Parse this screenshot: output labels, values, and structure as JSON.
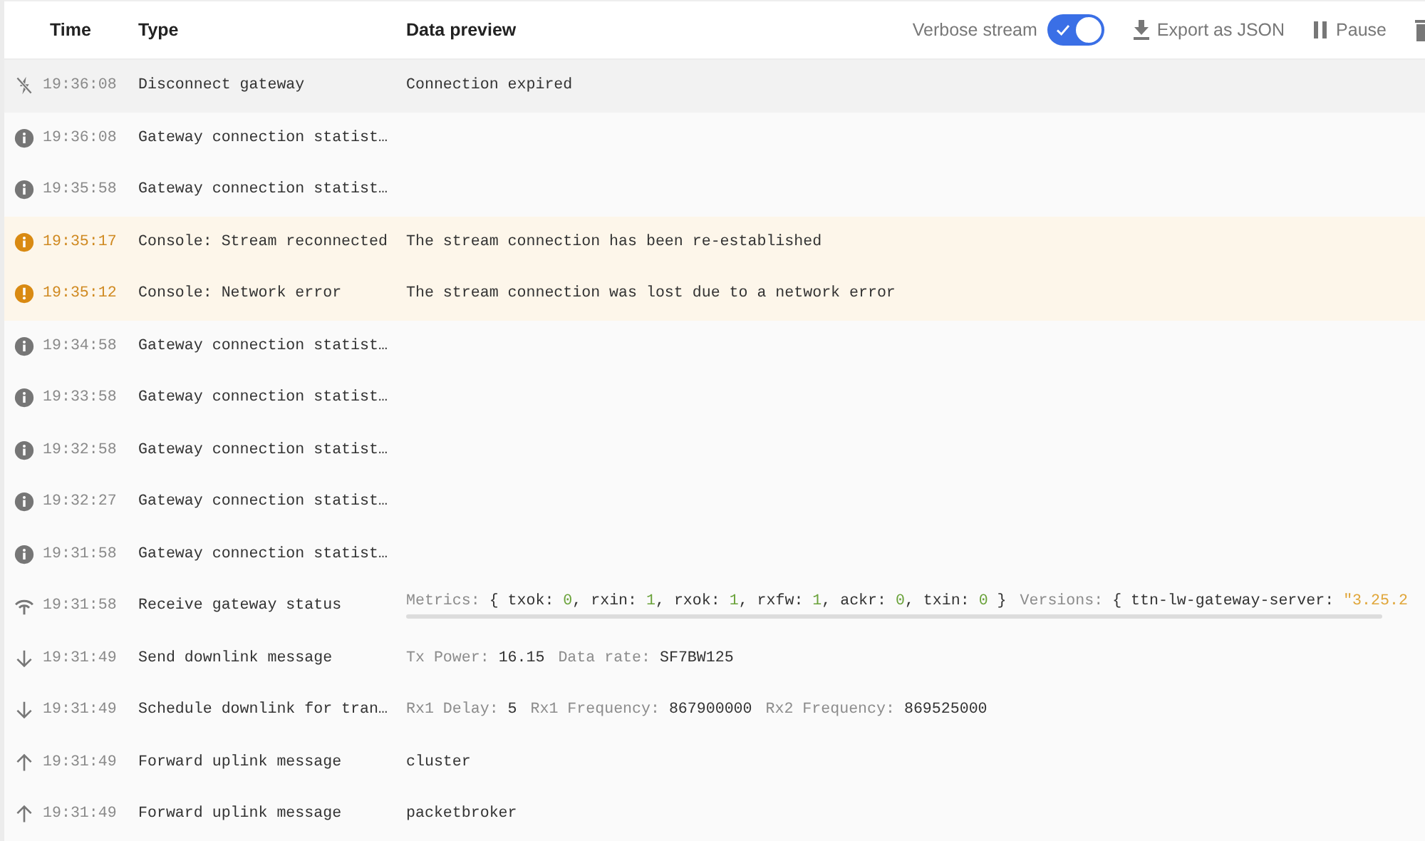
{
  "toolbar": {
    "columns": [
      "Time",
      "Type",
      "Data preview"
    ],
    "verbose_stream": {
      "label": "Verbose stream",
      "on": true
    },
    "actions": [
      {
        "kind": "export",
        "label": "Export as JSON"
      },
      {
        "kind": "pause",
        "label": "Pause"
      },
      {
        "kind": "clear"
      }
    ]
  },
  "events": [
    {
      "kind": "disconnect",
      "time": "19:36:08",
      "type": "Disconnect gateway",
      "preview": {
        "kind": "plain",
        "text": "Connection expired"
      }
    },
    {
      "kind": "info",
      "time": "19:36:08",
      "type": "Gateway connection statist…"
    },
    {
      "kind": "info",
      "time": "19:35:58",
      "type": "Gateway connection statist…"
    },
    {
      "kind": "notice",
      "time": "19:35:17",
      "type": "Console: Stream reconnected",
      "preview": {
        "kind": "plain",
        "text": "The stream connection has been re-established"
      }
    },
    {
      "kind": "error",
      "time": "19:35:12",
      "type": "Console: Network error",
      "preview": {
        "kind": "plain",
        "text": "The stream connection was lost due to a network error"
      }
    },
    {
      "kind": "info",
      "time": "19:34:58",
      "type": "Gateway connection statist…"
    },
    {
      "kind": "info",
      "time": "19:33:58",
      "type": "Gateway connection statist…"
    },
    {
      "kind": "info",
      "time": "19:32:58",
      "type": "Gateway connection statist…"
    },
    {
      "kind": "info",
      "time": "19:32:27",
      "type": "Gateway connection statist…"
    },
    {
      "kind": "info",
      "time": "19:31:58",
      "type": "Gateway connection statist…"
    },
    {
      "kind": "status",
      "time": "19:31:58",
      "type": "Receive gateway status",
      "preview": {
        "kind": "fields",
        "scrollbar": true,
        "fields": [
          {
            "label": "Metrics:",
            "parts": [
              {
                "kind": "value",
                "text": "{ txok:"
              },
              {
                "kind": "number",
                "text": "0"
              },
              {
                "kind": "value",
                "text": ", rxin:"
              },
              {
                "kind": "number",
                "text": "1"
              },
              {
                "kind": "value",
                "text": ", rxok:"
              },
              {
                "kind": "number",
                "text": "1"
              },
              {
                "kind": "value",
                "text": ", rxfw:"
              },
              {
                "kind": "number",
                "text": "1"
              },
              {
                "kind": "value",
                "text": ", ackr:"
              },
              {
                "kind": "number",
                "text": "0"
              },
              {
                "kind": "value",
                "text": ", txin:"
              },
              {
                "kind": "number",
                "text": "0"
              },
              {
                "kind": "close",
                "text": "}"
              }
            ]
          },
          {
            "label": "Versions:",
            "parts": [
              {
                "kind": "value",
                "text": "{ ttn-lw-gateway-server:"
              },
              {
                "kind": "string",
                "text": "\"3.25.2"
              }
            ]
          }
        ]
      }
    },
    {
      "kind": "downlink",
      "time": "19:31:49",
      "type": "Send downlink message",
      "preview": {
        "kind": "fields",
        "fields": [
          {
            "label": "Tx Power:",
            "parts": [
              {
                "kind": "value",
                "text": "16.15"
              }
            ]
          },
          {
            "label": "Data rate:",
            "parts": [
              {
                "kind": "value",
                "text": "SF7BW125"
              }
            ]
          }
        ]
      }
    },
    {
      "kind": "downlink",
      "time": "19:31:49",
      "type": "Schedule downlink for tran…",
      "preview": {
        "kind": "fields",
        "fields": [
          {
            "label": "Rx1 Delay:",
            "parts": [
              {
                "kind": "value",
                "text": "5"
              }
            ]
          },
          {
            "label": "Rx1 Frequency:",
            "parts": [
              {
                "kind": "value",
                "text": "867900000"
              }
            ]
          },
          {
            "label": "Rx2 Frequency:",
            "parts": [
              {
                "kind": "value",
                "text": "869525000"
              }
            ]
          }
        ]
      }
    },
    {
      "kind": "uplink",
      "time": "19:31:49",
      "type": "Forward uplink message",
      "preview": {
        "kind": "plain",
        "text": "cluster"
      }
    },
    {
      "kind": "uplink",
      "time": "19:31:49",
      "type": "Forward uplink message",
      "preview": {
        "kind": "plain",
        "text": "packetbroker"
      }
    }
  ]
}
